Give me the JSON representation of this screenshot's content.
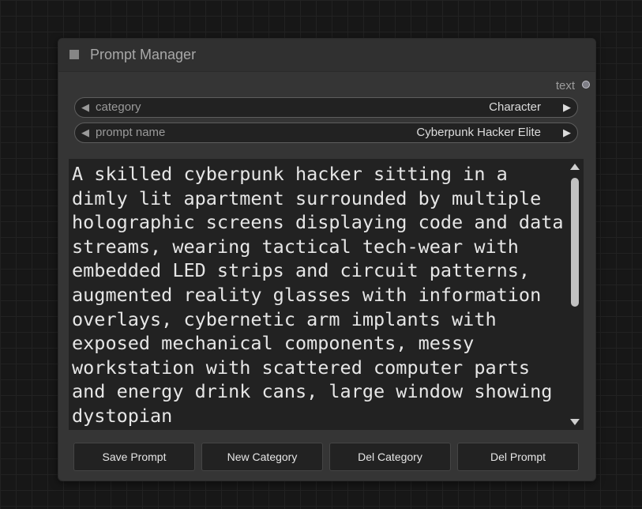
{
  "node": {
    "title": "Prompt Manager",
    "output_label": "text"
  },
  "widgets": {
    "category": {
      "label": "category",
      "value": "Character"
    },
    "prompt_name": {
      "label": "prompt name",
      "value": "Cyberpunk Hacker Elite"
    }
  },
  "prompt_text": "A skilled cyberpunk hacker sitting in a dimly lit apartment surrounded by multiple holographic screens displaying code and data streams, wearing tactical tech-wear with embedded LED strips and circuit patterns, augmented reality glasses with information overlays, cybernetic arm implants with exposed mechanical components, messy workstation with scattered computer parts and energy drink cans, large window showing dystopian",
  "buttons": {
    "save_prompt": "Save Prompt",
    "new_category": "New Category",
    "del_category": "Del Category",
    "del_prompt": "Del Prompt"
  },
  "icons": {
    "arrow_left": "◀",
    "arrow_right": "▶"
  },
  "colors": {
    "canvas_bg": "#171717",
    "node_bg": "#353535",
    "widget_bg": "#222222"
  }
}
